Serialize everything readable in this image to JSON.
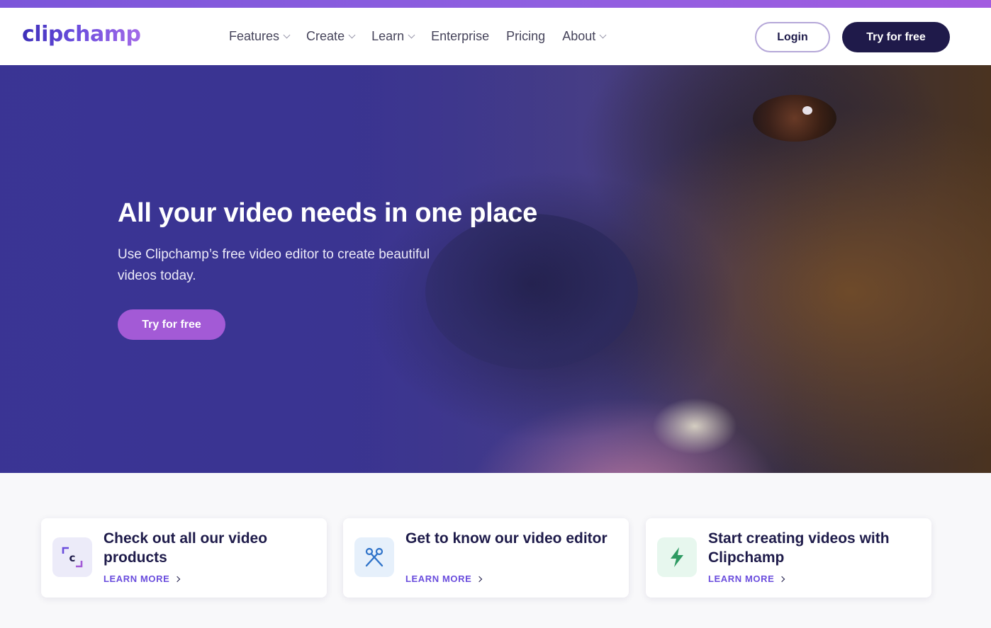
{
  "brand": {
    "logo_text": "clipchamp"
  },
  "nav": {
    "items": [
      {
        "label": "Features",
        "has_dropdown": true
      },
      {
        "label": "Create",
        "has_dropdown": true
      },
      {
        "label": "Learn",
        "has_dropdown": true
      },
      {
        "label": "Enterprise",
        "has_dropdown": false
      },
      {
        "label": "Pricing",
        "has_dropdown": false
      },
      {
        "label": "About",
        "has_dropdown": true
      }
    ],
    "login_label": "Login",
    "try_label": "Try for free"
  },
  "hero": {
    "title": "All your video needs in one place",
    "subtitle": "Use Clipchamp’s free video editor to create beautiful videos today.",
    "cta_label": "Try for free"
  },
  "cards": [
    {
      "title": "Check out all our video products",
      "link": "LEARN MORE",
      "icon": "clipchamp-c-icon"
    },
    {
      "title": "Get to know our video editor",
      "link": "LEARN MORE",
      "icon": "scissors-icon"
    },
    {
      "title": "Start creating videos with Clipchamp",
      "link": "LEARN MORE",
      "icon": "lightning-icon"
    }
  ],
  "colors": {
    "brand_dark": "#1f1a4a",
    "accent_purple": "#a35ad6",
    "link_purple": "#6a4ddd"
  }
}
